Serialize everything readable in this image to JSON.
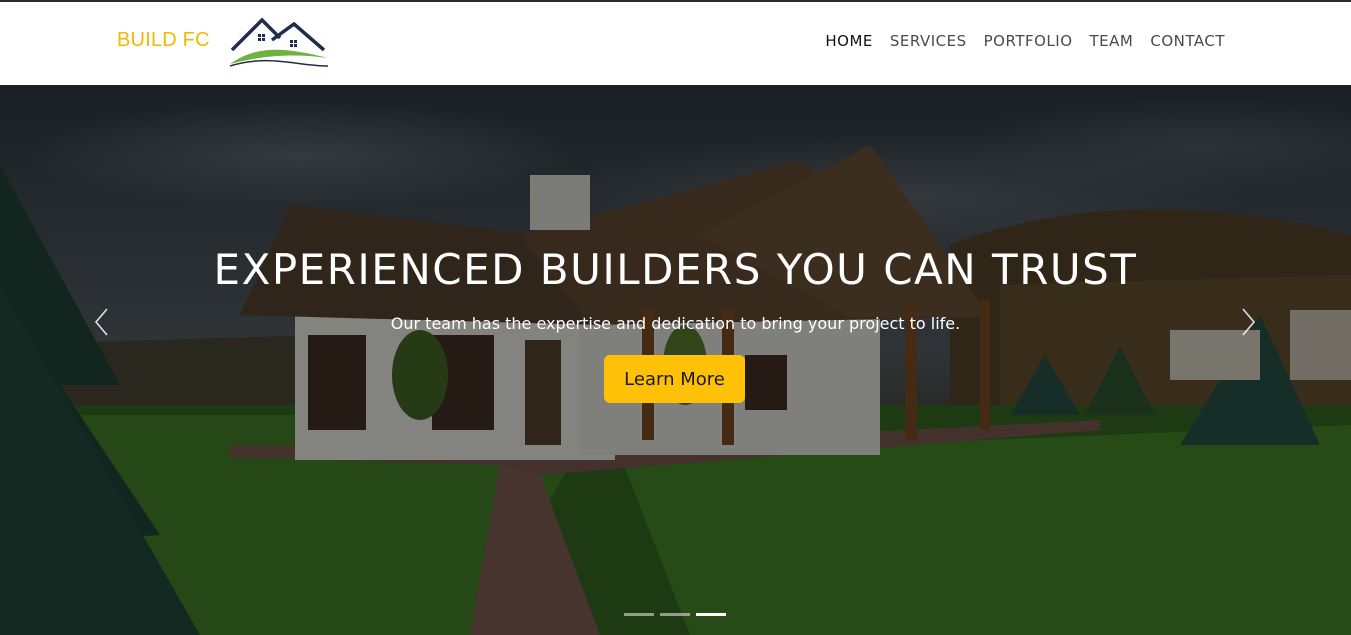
{
  "brand": {
    "name": "BUILD FC",
    "logo_icon": "house-roof-logo-icon"
  },
  "nav": {
    "items": [
      {
        "label": "HOME",
        "active": true
      },
      {
        "label": "SERVICES",
        "active": false
      },
      {
        "label": "PORTFOLIO",
        "active": false
      },
      {
        "label": "TEAM",
        "active": false
      },
      {
        "label": "CONTACT",
        "active": false
      }
    ]
  },
  "hero": {
    "headline": "EXPERIENCED BUILDERS YOU CAN TRUST",
    "subtitle": "Our team has the expertise and dedication to bring your project to life.",
    "cta_label": "Learn More",
    "prev_icon": "chevron-left-icon",
    "next_icon": "chevron-right-icon",
    "slides": 3,
    "active_slide": 3
  },
  "colors": {
    "accent": "#ffc107",
    "brand_text": "#f5b800",
    "logo_navy": "#1f2d4a",
    "logo_green": "#6cb33f"
  }
}
